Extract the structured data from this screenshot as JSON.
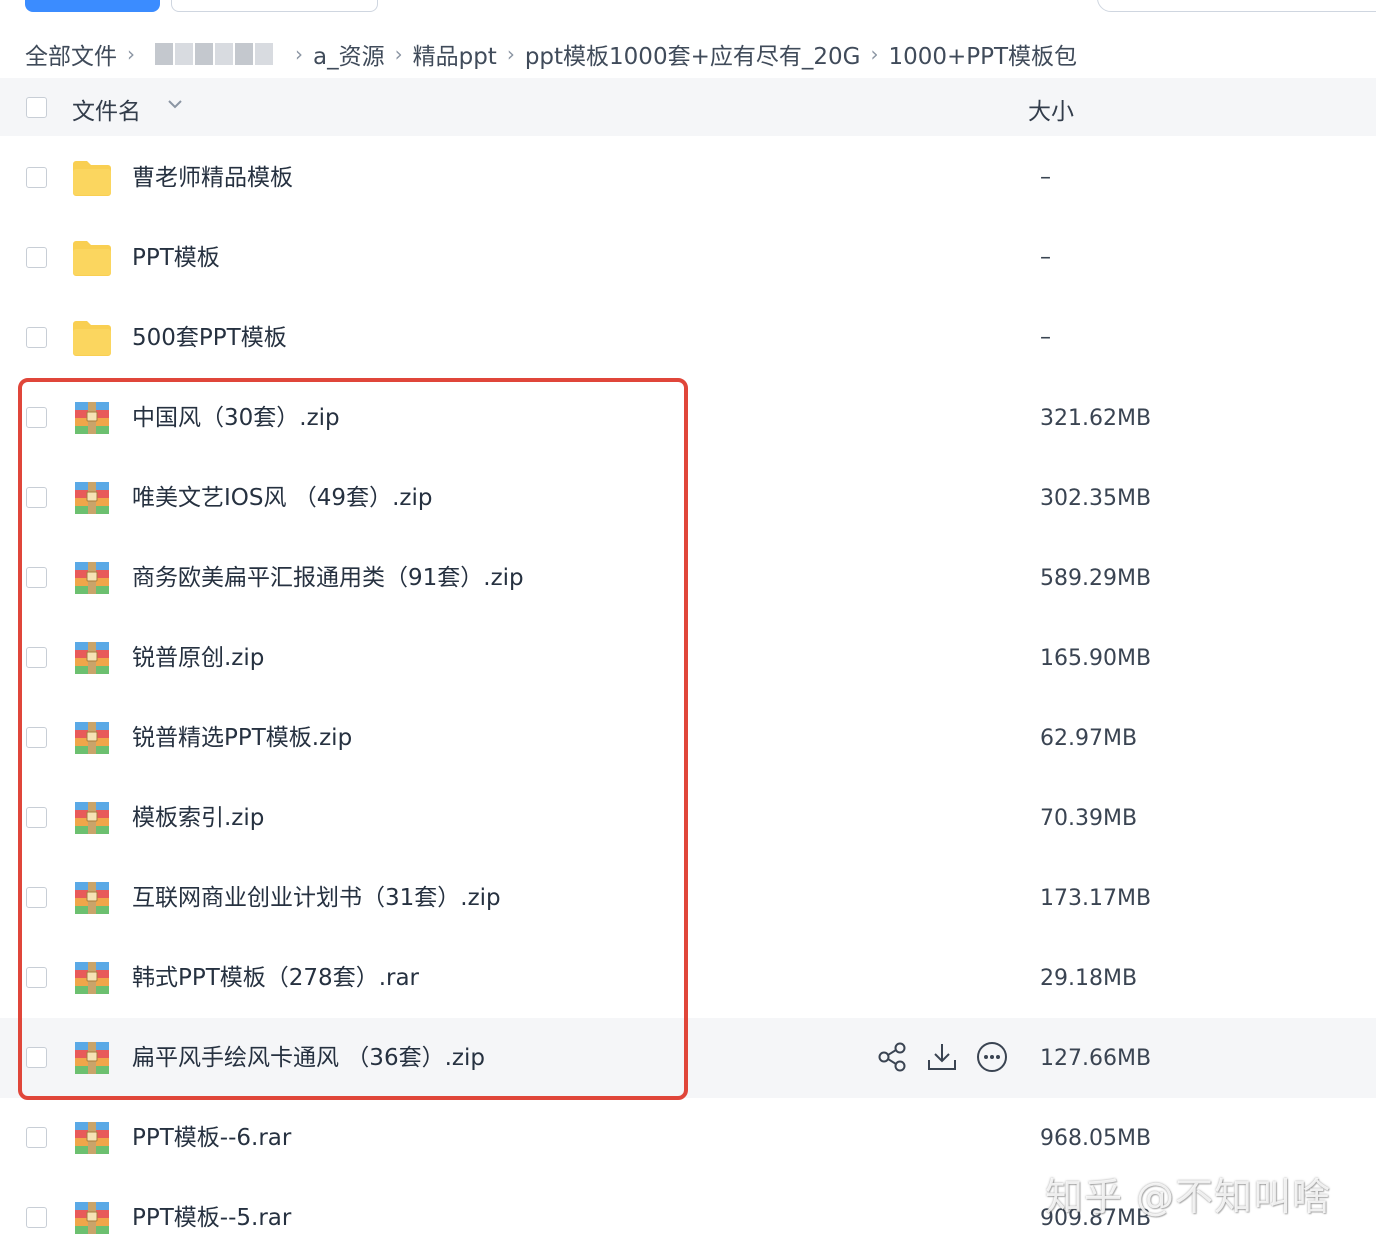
{
  "breadcrumb": {
    "root": "全部文件",
    "items": [
      "a_资源",
      "精品ppt",
      "ppt模板1000套+应有尽有_20G",
      "1000+PPT模板包"
    ]
  },
  "header": {
    "name_label": "文件名",
    "size_label": "大小"
  },
  "files": [
    {
      "name": "曹老师精品模板",
      "size": "–",
      "type": "folder"
    },
    {
      "name": "PPT模板",
      "size": "–",
      "type": "folder"
    },
    {
      "name": "500套PPT模板",
      "size": "–",
      "type": "folder"
    },
    {
      "name": "中国风（30套）.zip",
      "size": "321.62MB",
      "type": "archive"
    },
    {
      "name": "唯美文艺IOS风 （49套）.zip",
      "size": "302.35MB",
      "type": "archive"
    },
    {
      "name": "商务欧美扁平汇报通用类（91套）.zip",
      "size": "589.29MB",
      "type": "archive"
    },
    {
      "name": "锐普原创.zip",
      "size": "165.90MB",
      "type": "archive"
    },
    {
      "name": "锐普精选PPT模板.zip",
      "size": "62.97MB",
      "type": "archive"
    },
    {
      "name": "模板索引.zip",
      "size": "70.39MB",
      "type": "archive"
    },
    {
      "name": "互联网商业创业计划书（31套）.zip",
      "size": "173.17MB",
      "type": "archive"
    },
    {
      "name": "韩式PPT模板（278套）.rar",
      "size": "29.18MB",
      "type": "archive"
    },
    {
      "name": "扁平风手绘风卡通风 （36套）.zip",
      "size": "127.66MB",
      "type": "archive"
    },
    {
      "name": "PPT模板--6.rar",
      "size": "968.05MB",
      "type": "archive"
    },
    {
      "name": "PPT模板--5.rar",
      "size": "909.87MB",
      "type": "archive"
    }
  ],
  "watermark": "知乎 @不知叫啥",
  "colors": {
    "accent": "#3b8cff",
    "highlight_frame": "#e0463a",
    "folder": "#f9cf52",
    "row_hover": "#f5f6f8"
  }
}
